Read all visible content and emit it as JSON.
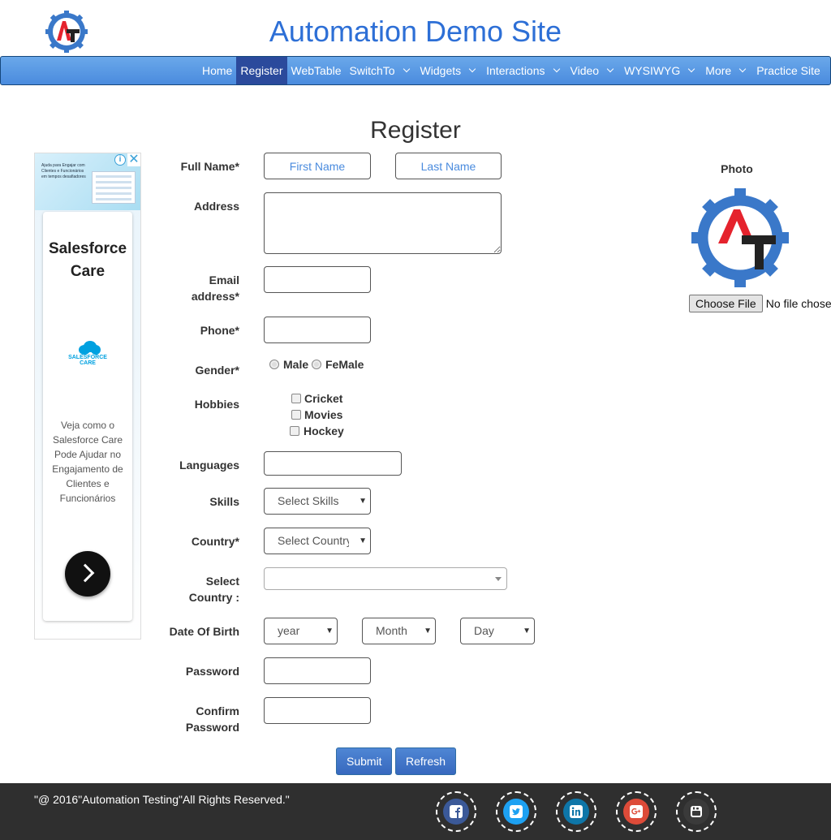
{
  "header": {
    "title": "Automation Demo Site",
    "logo_text": "AT"
  },
  "nav": {
    "items": [
      {
        "label": "Home",
        "dropdown": false
      },
      {
        "label": "Register",
        "dropdown": false,
        "active": true
      },
      {
        "label": "WebTable",
        "dropdown": false
      },
      {
        "label": "SwitchTo",
        "dropdown": true
      },
      {
        "label": "Widgets",
        "dropdown": true
      },
      {
        "label": "Interactions",
        "dropdown": true
      },
      {
        "label": "Video",
        "dropdown": true
      },
      {
        "label": "WYSIWYG",
        "dropdown": true
      },
      {
        "label": "More",
        "dropdown": true
      },
      {
        "label": "Practice Site",
        "dropdown": false
      }
    ]
  },
  "page": {
    "title": "Register"
  },
  "ad": {
    "top_text": "Ajuda para Engajar com Clientes e Funcionários em tempos desafiadores",
    "heading": "Salesforce Care",
    "brand": "SALESFORCE CARE",
    "body": "Veja como o Salesforce Care Pode Ajudar no Engajamento de Clientes e Funcionários",
    "info_icon": "i",
    "close_icon": "✕"
  },
  "form": {
    "full_name_label": "Full Name*",
    "first_name_placeholder": "First Name",
    "last_name_placeholder": "Last Name",
    "address_label": "Address",
    "email_label": "Email address*",
    "phone_label": "Phone*",
    "gender_label": "Gender*",
    "gender_options": [
      "Male",
      "FeMale"
    ],
    "hobbies_label": "Hobbies",
    "hobbies": [
      "Cricket",
      "Movies",
      "Hockey"
    ],
    "languages_label": "Languages",
    "skills_label": "Skills",
    "skills_value": "Select Skills",
    "country_label": "Country*",
    "country_value": "Select Country",
    "select_country_label": "Select Country :",
    "dob_label": "Date Of Birth",
    "year_value": "year",
    "month_value": "Month",
    "day_value": "Day",
    "password_label": "Password",
    "confirm_password_label": "Confirm Password",
    "submit_label": "Submit",
    "refresh_label": "Refresh"
  },
  "photo": {
    "label": "Photo",
    "choose_file_label": "Choose File",
    "file_status": "No file chosen"
  },
  "footer": {
    "copyright": "\"@ 2016\"Automation Testing\"All Rights Reserved.\"",
    "social": [
      {
        "icon": "facebook-icon",
        "color": "#3b5998"
      },
      {
        "icon": "twitter-icon",
        "color": "#1da1f2"
      },
      {
        "icon": "linkedin-icon",
        "color": "#0e76a8"
      },
      {
        "icon": "google-plus-icon",
        "color": "#dd4b39"
      },
      {
        "icon": "youtube-icon",
        "color": "#3a3a3a"
      }
    ]
  },
  "colors": {
    "accent": "#2d6fd6",
    "nav_active": "#2b4a9c",
    "footer_bg": "#2f2f2f"
  }
}
